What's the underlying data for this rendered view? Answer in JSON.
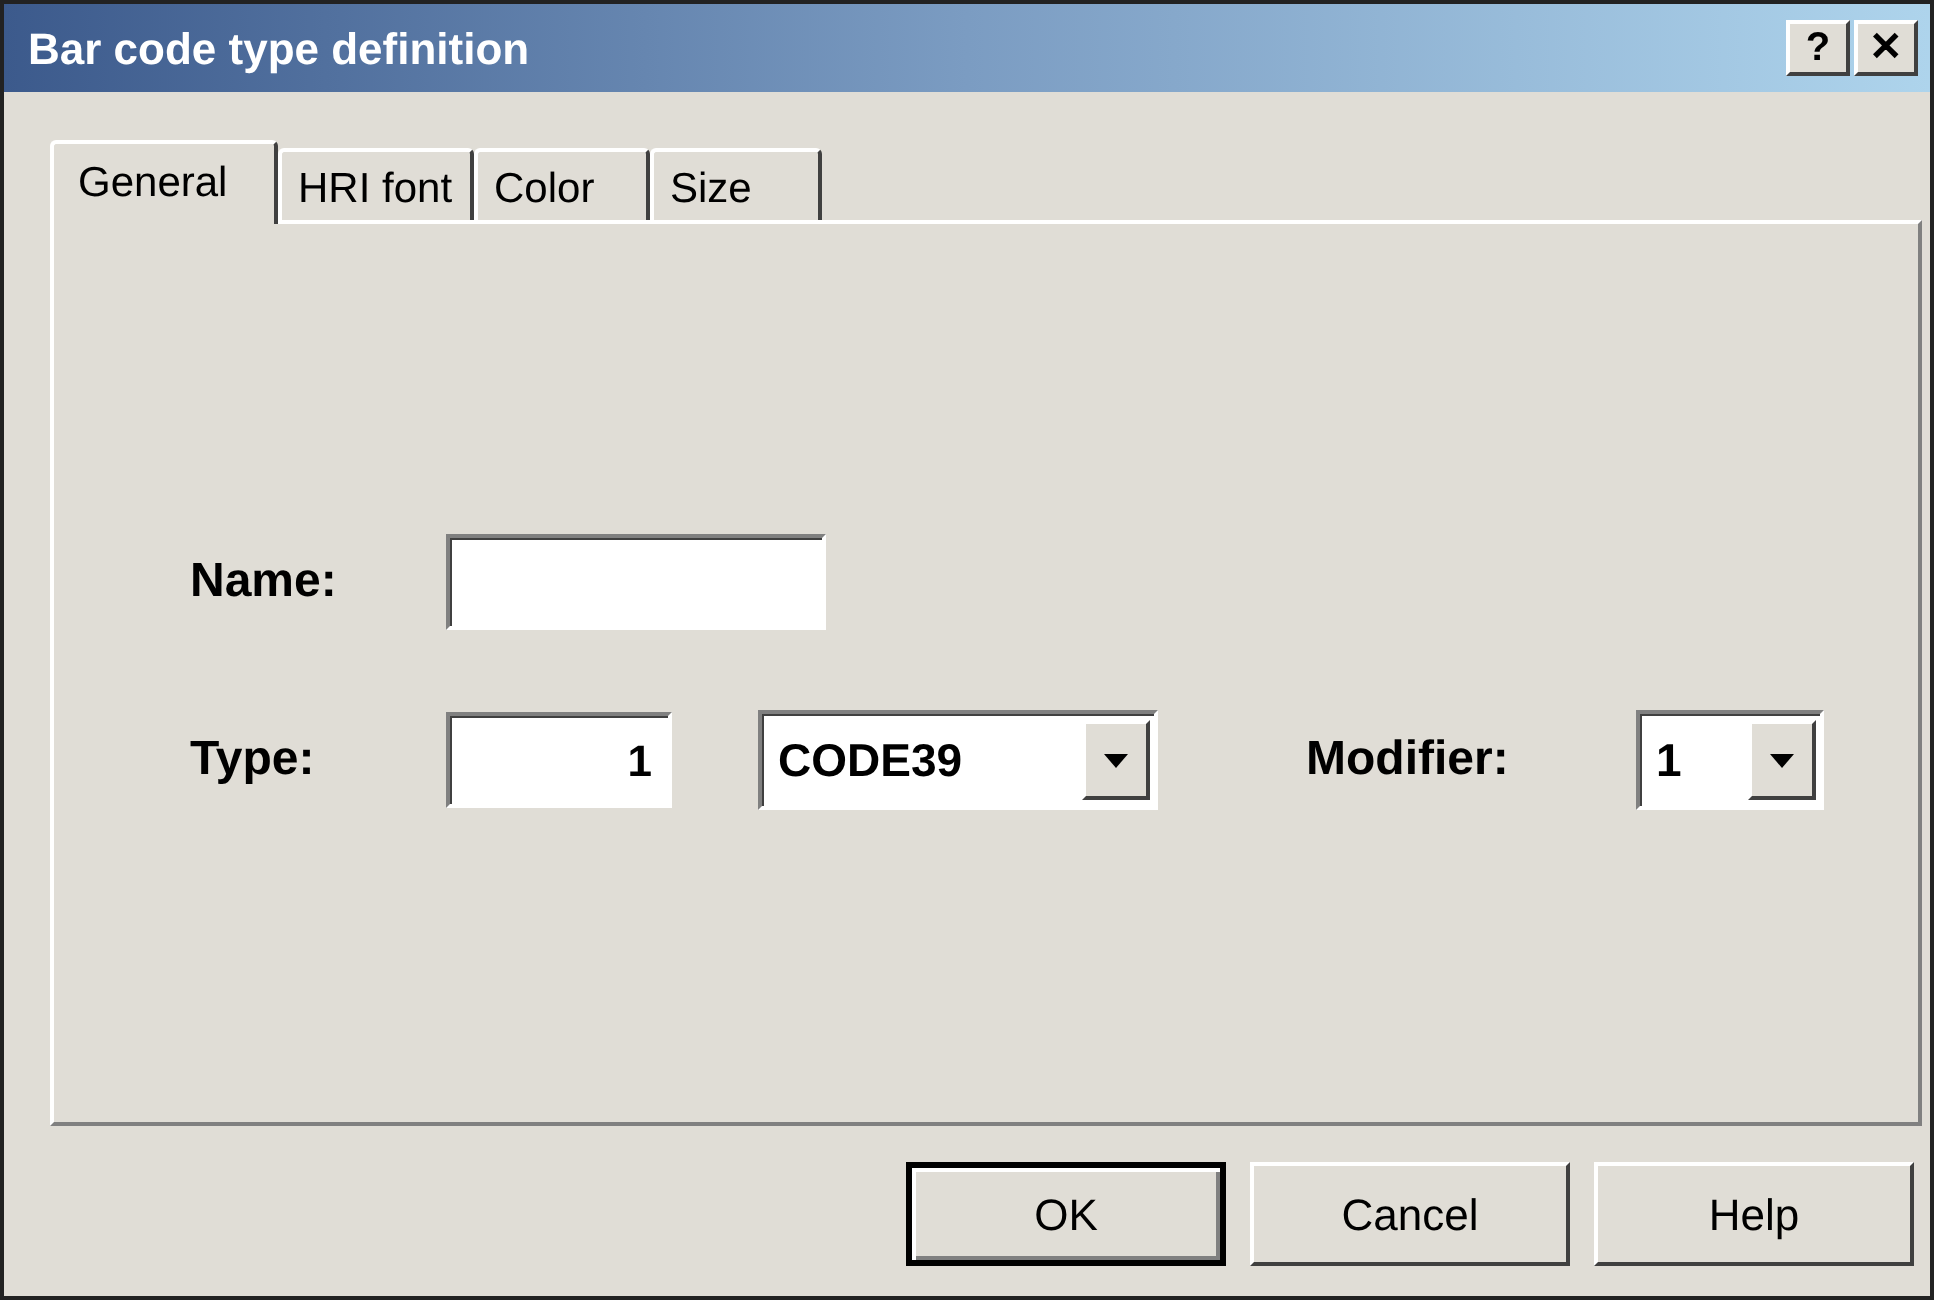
{
  "window": {
    "title": "Bar code type definition",
    "title_buttons": [
      "?",
      "✕"
    ]
  },
  "tabs": [
    {
      "label": "General",
      "selected": true
    },
    {
      "label": "HRI font",
      "selected": false
    },
    {
      "label": "Color",
      "selected": false
    },
    {
      "label": "Size",
      "selected": false
    }
  ],
  "name": {
    "label": "Name:"
  },
  "type": {
    "label": "Type:",
    "value": "1",
    "combo": "CODE39"
  },
  "modifier": {
    "label": "Modifier:",
    "value": "1"
  },
  "buttons": [
    {
      "label": "OK",
      "default": true
    },
    {
      "label": "Cancel",
      "default": false
    },
    {
      "label": "Help",
      "default": false
    }
  ]
}
